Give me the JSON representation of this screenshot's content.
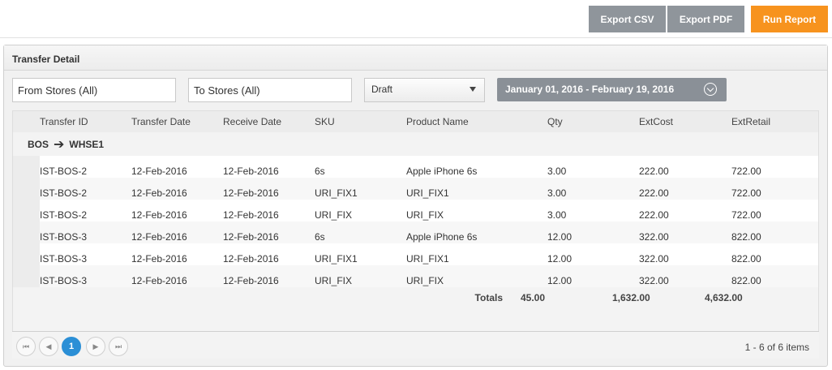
{
  "toolbar": {
    "export_csv": "Export CSV",
    "export_pdf": "Export PDF",
    "run_report": "Run Report"
  },
  "panel": {
    "title": "Transfer Detail"
  },
  "filters": {
    "from_stores": "From Stores (All)",
    "to_stores": "To Stores (All)",
    "status": "Draft",
    "date_range": "January 01, 2016 - February 19, 2016"
  },
  "grid": {
    "columns": [
      "Transfer ID",
      "Transfer Date",
      "Receive Date",
      "SKU",
      "Product Name",
      "Qty",
      "ExtCost",
      "ExtRetail"
    ],
    "group": {
      "from": "BOS",
      "to": "WHSE1"
    },
    "rows": [
      [
        "IST-BOS-2",
        "12-Feb-2016",
        "12-Feb-2016",
        "6s",
        "Apple iPhone 6s",
        "3.00",
        "222.00",
        "722.00"
      ],
      [
        "IST-BOS-2",
        "12-Feb-2016",
        "12-Feb-2016",
        "URI_FIX1",
        "URI_FIX1",
        "3.00",
        "222.00",
        "722.00"
      ],
      [
        "IST-BOS-2",
        "12-Feb-2016",
        "12-Feb-2016",
        "URI_FIX",
        "URI_FIX",
        "3.00",
        "222.00",
        "722.00"
      ],
      [
        "IST-BOS-3",
        "12-Feb-2016",
        "12-Feb-2016",
        "6s",
        "Apple iPhone 6s",
        "12.00",
        "322.00",
        "822.00"
      ],
      [
        "IST-BOS-3",
        "12-Feb-2016",
        "12-Feb-2016",
        "URI_FIX1",
        "URI_FIX1",
        "12.00",
        "322.00",
        "822.00"
      ],
      [
        "IST-BOS-3",
        "12-Feb-2016",
        "12-Feb-2016",
        "URI_FIX",
        "URI_FIX",
        "12.00",
        "322.00",
        "822.00"
      ]
    ],
    "totals": {
      "label": "Totals",
      "qty": "45.00",
      "cost": "1,632.00",
      "retail": "4,632.00"
    }
  },
  "pager": {
    "current_page": "1",
    "info": "1 - 6 of 6 items"
  },
  "colors": {
    "accent": "#f7931e",
    "button_gray": "#8f959b",
    "page_active": "#2b8fd6"
  }
}
